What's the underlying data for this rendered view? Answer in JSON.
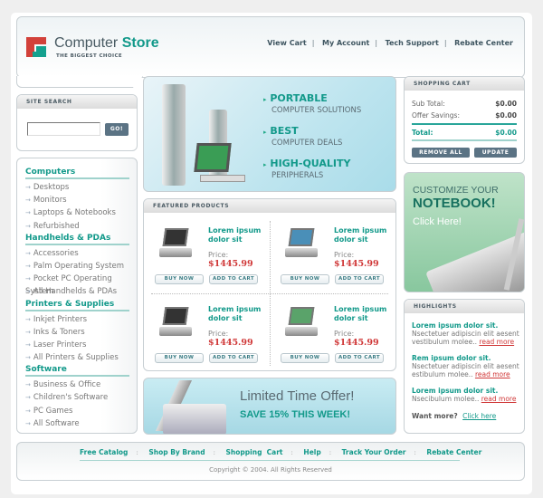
{
  "header": {
    "logo_main": "Computer",
    "logo_accent": "Store",
    "tagline": "THE BIGGEST CHOICE",
    "nav": [
      "View Cart",
      "My Account",
      "Tech Support",
      "Rebate Center"
    ]
  },
  "search": {
    "title": "SITE SEARCH",
    "value": "",
    "placeholder": "",
    "go": "GO!"
  },
  "categories": [
    {
      "title": "Computers",
      "items": [
        "Desktops",
        "Monitors",
        "Laptops & Notebooks",
        "Refurbished"
      ]
    },
    {
      "title": "Handhelds & PDAs",
      "items": [
        "Accessories",
        "Palm Operating System",
        "Pocket PC Operating System",
        "All Handhelds & PDAs"
      ]
    },
    {
      "title": "Printers & Supplies",
      "items": [
        "Inkjet Printers",
        "Inks & Toners",
        "Laser Printers",
        "All Printers & Supplies"
      ]
    },
    {
      "title": "Software",
      "items": [
        "Business & Office",
        "Children's Software",
        "PC Games",
        "All Software"
      ]
    }
  ],
  "banner": {
    "lines": [
      {
        "head": "PORTABLE",
        "sub": "COMPUTER SOLUTIONS"
      },
      {
        "head": "BEST",
        "sub": "COMPUTER DEALS"
      },
      {
        "head": "HIGH-QUALITY",
        "sub": "PERIPHERALS"
      }
    ]
  },
  "featured": {
    "title": "FEATURED PRODUCTS",
    "products": [
      {
        "name": "Lorem ipsum dolor sit",
        "price_label": "Price:",
        "price": "$1445.99",
        "buy": "BUY NOW",
        "add": "ADD TO CART",
        "image": "laptop-icon"
      },
      {
        "name": "Lorem ipsum dolor sit",
        "price_label": "Price:",
        "price": "$1445.99",
        "buy": "BUY NOW",
        "add": "ADD TO CART",
        "image": "tablet-pc-icon"
      },
      {
        "name": "Lorem ipsum dolor sit",
        "price_label": "Price:",
        "price": "$1445.99",
        "buy": "BUY NOW",
        "add": "ADD TO CART",
        "image": "laptop-icon"
      },
      {
        "name": "Lorem ipsum dolor sit",
        "price_label": "Price:",
        "price": "$1445.99",
        "buy": "BUY NOW",
        "add": "ADD TO CART",
        "image": "desktop-icon"
      }
    ]
  },
  "offer": {
    "line1": "Limited Time Offer!",
    "line2": "SAVE 15% THIS WEEK!"
  },
  "cart": {
    "title": "SHOPPING CART",
    "subtotal_label": "Sub Total:",
    "subtotal": "$0.00",
    "savings_label": "Offer Savings:",
    "savings": "$0.00",
    "total_label": "Total:",
    "total": "$0.00",
    "remove": "REMOVE ALL",
    "update": "UPDATE"
  },
  "promo": {
    "line1": "CUSTOMIZE YOUR",
    "line2": "NOTEBOOK!",
    "cta": "Click Here!"
  },
  "highlights": {
    "title": "HIGHLIGHTS",
    "items": [
      {
        "title": "Lorem ipsum dolor sit.",
        "body": "Nsectetuer adipiscin elit aesent vestibulum molee..",
        "more": "read more"
      },
      {
        "title": "Rem ipsum dolor sit.",
        "body": "Nsectetuer adipiscin elit aesent estibulum molee..",
        "more": "read more"
      },
      {
        "title": "Lorem ipsum dolor sit.",
        "body": "Nsecibulum molee..",
        "more": "read more"
      }
    ],
    "want": "Want more?",
    "click": "Click here"
  },
  "footer": {
    "links": [
      "Free Catalog",
      "Shop By Brand",
      "Shopping  Cart",
      "Help",
      "Track Your Order",
      "Rebate Center"
    ],
    "copyright": "Copyright © 2004. All Rights Reserved"
  },
  "colors": {
    "accent": "#12998a",
    "price": "#d03838",
    "button": "#5b7384"
  }
}
